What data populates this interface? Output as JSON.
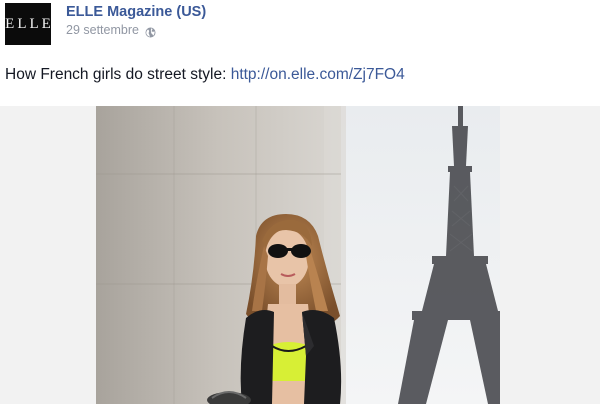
{
  "post": {
    "page_name": "ELLE Magazine (US)",
    "avatar_text": "ELLE",
    "date": "29 settembre",
    "privacy_icon": "globe-icon",
    "status_text": "How French girls do street style: ",
    "link_text": "http://on.elle.com/Zj7FO4"
  },
  "colors": {
    "link_blue": "#3b5998",
    "meta_gray": "#9197a3",
    "text_dark": "#141823",
    "frame_bg": "#f2f2f2"
  }
}
